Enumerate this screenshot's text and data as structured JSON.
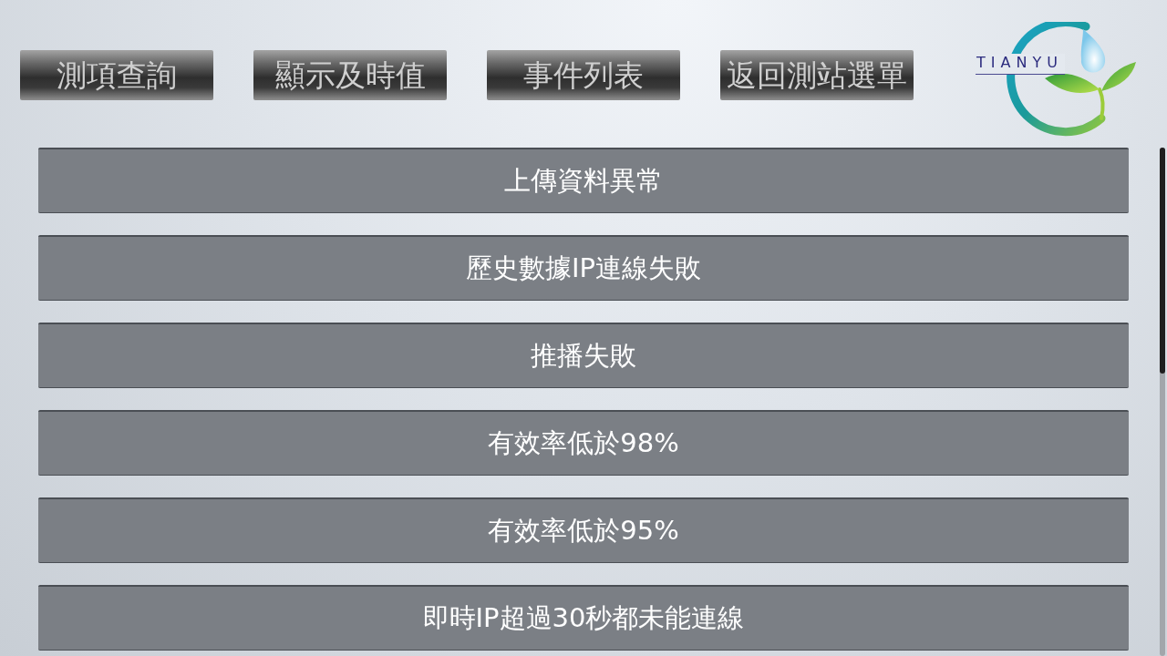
{
  "nav_buttons": [
    {
      "label": "測項查詢"
    },
    {
      "label": "顯示及時值"
    },
    {
      "label": "事件列表"
    },
    {
      "label": "返回測站選單"
    }
  ],
  "logo": {
    "text": "TIANYU"
  },
  "events": [
    {
      "label": "上傳資料異常"
    },
    {
      "label": "歷史數據IP連線失敗"
    },
    {
      "label": "推播失敗"
    },
    {
      "label": "有效率低於98%"
    },
    {
      "label": "有效率低於95%"
    },
    {
      "label": "即時IP超過30秒都未能連線"
    }
  ]
}
